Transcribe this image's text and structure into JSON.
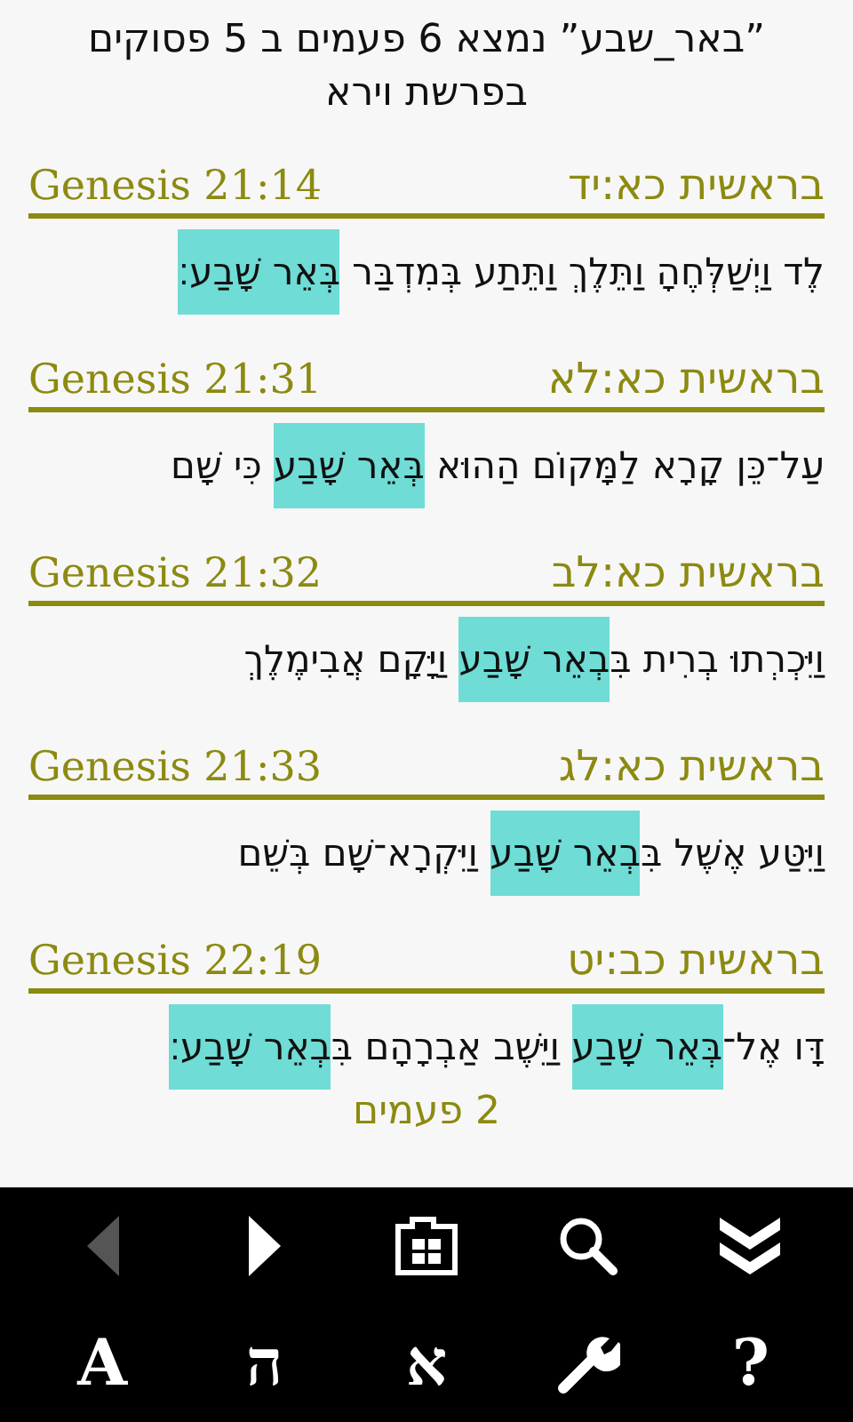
{
  "title": "”באר_שבע” נמצא 6 פעמים ב 5 פסוקים בפרשת וירא",
  "verses": [
    {
      "ref_en": "Genesis 21:14",
      "ref_he": "בראשית כא:יד",
      "segments": [
        {
          "text": "לֶד וַיְשַׁלְּחֶהָ וַתֵּלֶךְ וַתֵּתַע בְּמִדְבַּר ",
          "highlighted": false
        },
        {
          "text": "בְּאֵר שָׁבַע׃",
          "highlighted": true
        }
      ]
    },
    {
      "ref_en": "Genesis 21:31",
      "ref_he": "בראשית כא:לא",
      "segments": [
        {
          "text": "עַל־כֵּן קָרָא לַמָּקוֹם הַהוּא ",
          "highlighted": false
        },
        {
          "text": "בְּאֵר שָׁבַע",
          "highlighted": true
        },
        {
          "text": " כִּי שָׁם",
          "highlighted": false
        }
      ]
    },
    {
      "ref_en": "Genesis 21:32",
      "ref_he": "בראשית כא:לב",
      "segments": [
        {
          "text": "וַיִּכְרְתוּ בְרִית בִּ",
          "highlighted": false
        },
        {
          "text": "בְאֵר שָׁבַע",
          "highlighted": true
        },
        {
          "text": " וַיָּקָם אֲבִימֶלֶךְ",
          "highlighted": false
        }
      ]
    },
    {
      "ref_en": "Genesis 21:33",
      "ref_he": "בראשית כא:לג",
      "segments": [
        {
          "text": "וַיִּטַּע אֶשֶׁל בִּ",
          "highlighted": false
        },
        {
          "text": "בְאֵר שָׁבַע",
          "highlighted": true
        },
        {
          "text": " וַיִּקְרָא־שָׁם בְּשֵׁם",
          "highlighted": false
        }
      ]
    },
    {
      "ref_en": "Genesis 22:19",
      "ref_he": "בראשית כב:יט",
      "segments": [
        {
          "text": "דָּו אֶל־",
          "highlighted": false
        },
        {
          "text": "בְּאֵר שָׁבַע",
          "highlighted": true
        },
        {
          "text": " וַיֵּשֶׁב אַבְרָהָם בִּ",
          "highlighted": false
        },
        {
          "text": "בְאֵר שָׁבַע׃",
          "highlighted": true
        }
      ],
      "count": "2 פעמים"
    }
  ],
  "toolbar": [
    {
      "kind": "collapse",
      "disabled": false
    },
    {
      "kind": "search",
      "disabled": false
    },
    {
      "kind": "grid",
      "disabled": false
    },
    {
      "kind": "forward",
      "disabled": false
    },
    {
      "kind": "back",
      "disabled": true
    },
    {
      "kind": "letter",
      "label": "?",
      "disabled": false
    },
    {
      "kind": "settings",
      "disabled": false
    },
    {
      "kind": "letter",
      "label": "א",
      "disabled": false
    },
    {
      "kind": "letter",
      "label": "ה",
      "disabled": false
    },
    {
      "kind": "letter",
      "label": "A",
      "disabled": false
    }
  ]
}
